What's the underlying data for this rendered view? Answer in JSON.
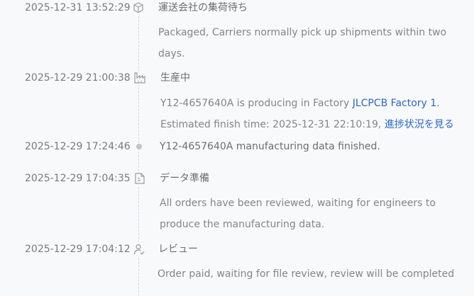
{
  "events": [
    {
      "time": "2025-12-31 13:52:29",
      "icon": "package-icon",
      "title": "運送会社の集荷待ち",
      "desc_line1": "Packaged, Carriers normally pick up shipments within two",
      "desc_line2": "days."
    },
    {
      "time": "2025-12-29 21:00:38",
      "icon": "factory-icon",
      "title": "生産中",
      "desc_line1_prefix": "Y12-4657640A is producing in Factory ",
      "factory_link": "JLCPCB Factory 1",
      "desc_line1_suffix": ".",
      "desc_line2_prefix": "Estimated finish time: 2025-12-31 22:10:19, ",
      "progress_link": "進捗状況を見る"
    },
    {
      "time": "2025-12-29 17:24:46",
      "icon": "dot-icon",
      "title": "Y12-4657640A manufacturing data finished."
    },
    {
      "time": "2025-12-29 17:04:35",
      "icon": "data-file-icon",
      "title": "データ準備",
      "desc_line1": "All orders have been reviewed, waiting for engineers to",
      "desc_line2": "produce the manufacturing data."
    },
    {
      "time": "2025-12-29 17:04:12",
      "icon": "reviewer-icon",
      "title": "レビュー",
      "desc_line1": "Order paid, waiting for file review, review will be completed"
    }
  ],
  "colors": {
    "background": "#f8f9fb",
    "link": "#2b66c9",
    "timeline": "#d2d5da",
    "text": "#707070"
  }
}
